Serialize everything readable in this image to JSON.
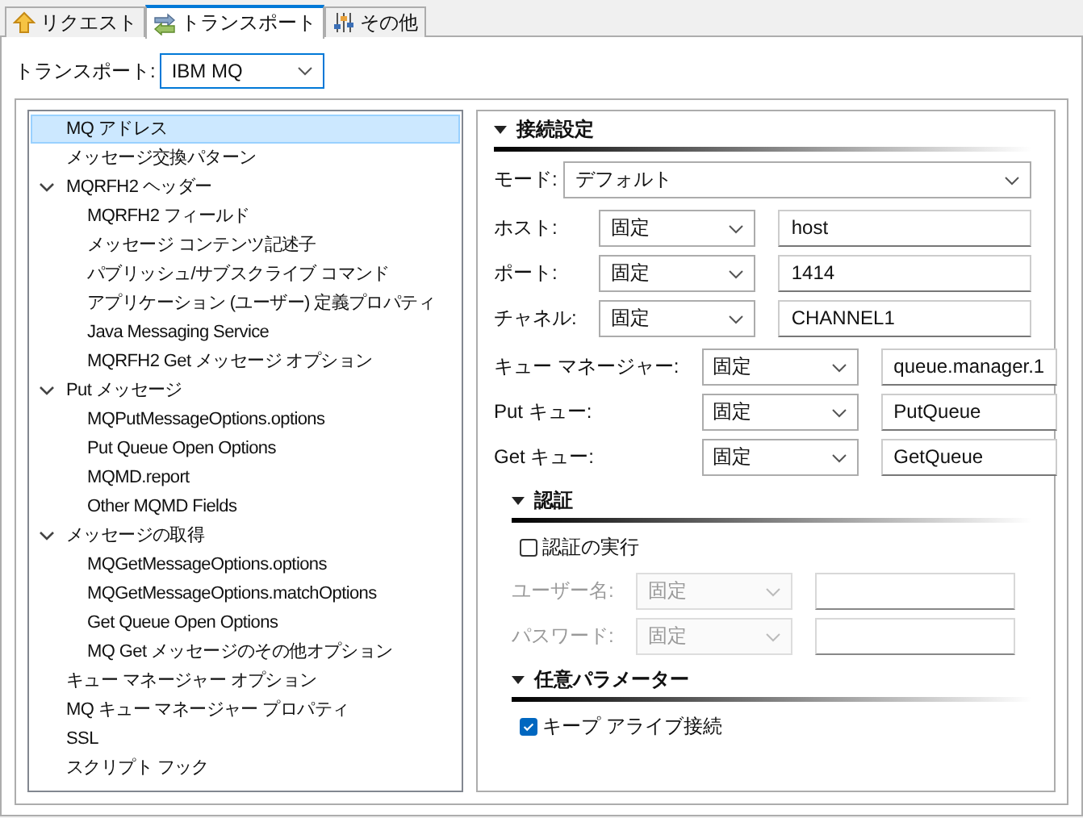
{
  "tabs": [
    {
      "label": "リクエスト",
      "selected": false
    },
    {
      "label": "トランスポート",
      "selected": true
    },
    {
      "label": "その他",
      "selected": false
    }
  ],
  "transport": {
    "label": "トランスポート:",
    "value": "IBM MQ"
  },
  "tree": [
    {
      "label": "MQ アドレス",
      "selected": true
    },
    {
      "label": "メッセージ交換パターン",
      "selected": false
    },
    {
      "label": "MQRFH2 ヘッダー",
      "selected": false,
      "expanded": true,
      "children": [
        {
          "label": "MQRFH2 フィールド",
          "selected": false
        },
        {
          "label": "メッセージ コンテンツ記述子",
          "selected": false
        },
        {
          "label": "パブリッシュ/サブスクライブ コマンド",
          "selected": false
        },
        {
          "label": "アプリケーション (ユーザー) 定義プロパティ",
          "selected": false
        },
        {
          "label": "Java Messaging Service",
          "selected": false
        },
        {
          "label": "MQRFH2 Get メッセージ オプション",
          "selected": false
        }
      ]
    },
    {
      "label": "Put メッセージ",
      "selected": false,
      "expanded": true,
      "children": [
        {
          "label": "MQPutMessageOptions.options",
          "selected": false
        },
        {
          "label": "Put Queue Open Options",
          "selected": false
        },
        {
          "label": "MQMD.report",
          "selected": false
        },
        {
          "label": "Other MQMD Fields",
          "selected": false
        }
      ]
    },
    {
      "label": "メッセージの取得",
      "selected": false,
      "expanded": true,
      "children": [
        {
          "label": "MQGetMessageOptions.options",
          "selected": false
        },
        {
          "label": "MQGetMessageOptions.matchOptions",
          "selected": false
        },
        {
          "label": "Get Queue Open Options",
          "selected": false
        },
        {
          "label": "MQ Get メッセージのその他オプション",
          "selected": false
        }
      ]
    },
    {
      "label": "キュー マネージャー オプション",
      "selected": false
    },
    {
      "label": "MQ キュー マネージャー プロパティ",
      "selected": false
    },
    {
      "label": "SSL",
      "selected": false
    },
    {
      "label": "スクリプト フック",
      "selected": false
    }
  ],
  "sections": [
    {
      "title": "接続設定",
      "expanded": true,
      "groups": [
        {
          "kind": "select",
          "rows": [
            {
              "label": "モード:",
              "value": "デフォルト"
            }
          ]
        },
        {
          "kind": "mapped",
          "rows": [
            {
              "label": "ホスト:",
              "mode": "固定",
              "value": "host",
              "disabled": false
            },
            {
              "label": "ポート:",
              "mode": "固定",
              "value": "1414",
              "disabled": false
            },
            {
              "label": "チャネル:",
              "mode": "固定",
              "value": "CHANNEL1",
              "disabled": false
            }
          ]
        },
        {
          "kind": "mapped",
          "rows": [
            {
              "label": "キュー マネージャー:",
              "mode": "固定",
              "value": "queue.manager.1",
              "disabled": false
            },
            {
              "label": "Put キュー:",
              "mode": "固定",
              "value": "PutQueue",
              "disabled": false
            },
            {
              "label": "Get キュー:",
              "mode": "固定",
              "value": "GetQueue",
              "disabled": false
            }
          ]
        }
      ]
    },
    {
      "title": "認証",
      "expanded": true,
      "groups": [
        {
          "kind": "checkbox",
          "rows": [
            {
              "label": "認証の実行",
              "checked": false
            }
          ]
        },
        {
          "kind": "mapped",
          "rows": [
            {
              "label": "ユーザー名:",
              "mode": "固定",
              "disabled": true
            },
            {
              "label": "パスワード:",
              "mode": "固定",
              "disabled": true
            }
          ]
        }
      ]
    },
    {
      "title": "任意パラメーター",
      "expanded": true,
      "groups": [
        {
          "kind": "checkbox",
          "rows": [
            {
              "label": "キープ アライブ接続",
              "checked": true
            }
          ]
        }
      ]
    }
  ]
}
